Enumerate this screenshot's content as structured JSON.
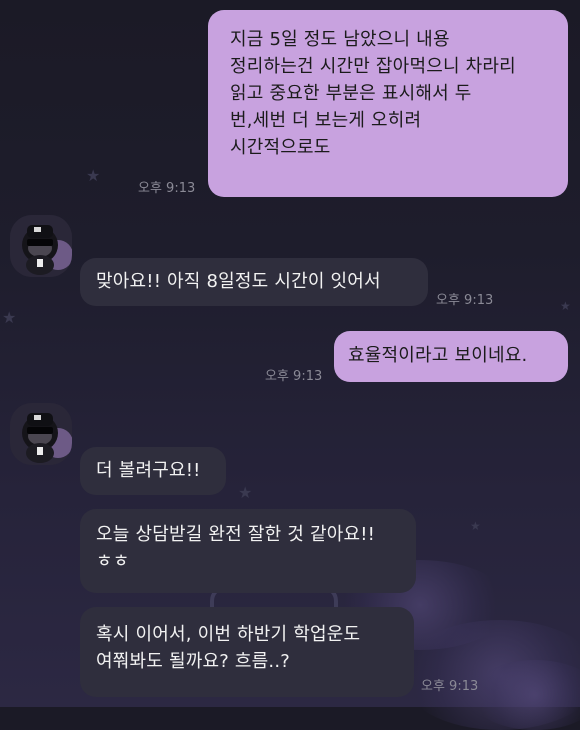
{
  "theme": {
    "outgoing_bubble_color": "#c8a2df",
    "incoming_bubble_color": "#2f2e3d",
    "timestamp_color": "#8b8a96"
  },
  "messages": [
    {
      "direction": "outgoing",
      "lines": [
        "지금 5일 정도 남았으니 내용",
        "정리하는건 시간만 잡아먹으니 차라리",
        "읽고 중요한 부분은 표시해서 두",
        "번,세번 더 보는게 오히려",
        "시간적으로도"
      ],
      "time": "오후 9:13"
    },
    {
      "direction": "incoming",
      "lines": [
        "맞아요!! 아직 8일정도 시간이 잇어서"
      ],
      "time": "오후 9:13"
    },
    {
      "direction": "outgoing",
      "lines": [
        "효율적이라고 보이네요."
      ],
      "time": "오후 9:13"
    },
    {
      "direction": "incoming",
      "lines": [
        "더 볼려구요!!"
      ]
    },
    {
      "direction": "incoming",
      "lines": [
        "오늘 상담받길 완전 잘한 것 같아요!!",
        "ㅎㅎ"
      ]
    },
    {
      "direction": "incoming",
      "lines": [
        "혹시 이어서, 이번 하반기 학업운도",
        "여쭤봐도 될까요? 흐름..?"
      ],
      "time": "오후 9:13"
    }
  ]
}
